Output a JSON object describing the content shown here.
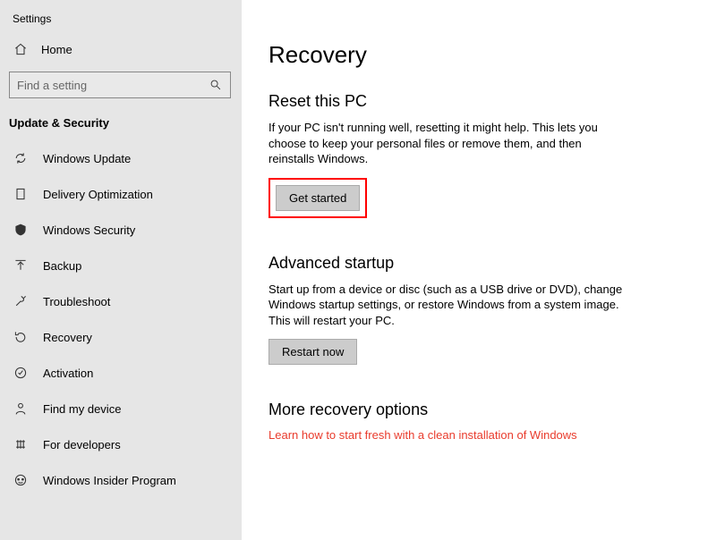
{
  "app_title": "Settings",
  "home_label": "Home",
  "search": {
    "placeholder": "Find a setting"
  },
  "category_header": "Update & Security",
  "sidebar": {
    "items": [
      {
        "label": "Windows Update"
      },
      {
        "label": "Delivery Optimization"
      },
      {
        "label": "Windows Security"
      },
      {
        "label": "Backup"
      },
      {
        "label": "Troubleshoot"
      },
      {
        "label": "Recovery"
      },
      {
        "label": "Activation"
      },
      {
        "label": "Find my device"
      },
      {
        "label": "For developers"
      },
      {
        "label": "Windows Insider Program"
      }
    ]
  },
  "page": {
    "title": "Recovery",
    "reset": {
      "heading": "Reset this PC",
      "desc": "If your PC isn't running well, resetting it might help. This lets you choose to keep your personal files or remove them, and then reinstalls Windows.",
      "button": "Get started"
    },
    "advanced": {
      "heading": "Advanced startup",
      "desc": "Start up from a device or disc (such as a USB drive or DVD), change Windows startup settings, or restore Windows from a system image. This will restart your PC.",
      "button": "Restart now"
    },
    "more": {
      "heading": "More recovery options",
      "link": "Learn how to start fresh with a clean installation of Windows"
    }
  }
}
